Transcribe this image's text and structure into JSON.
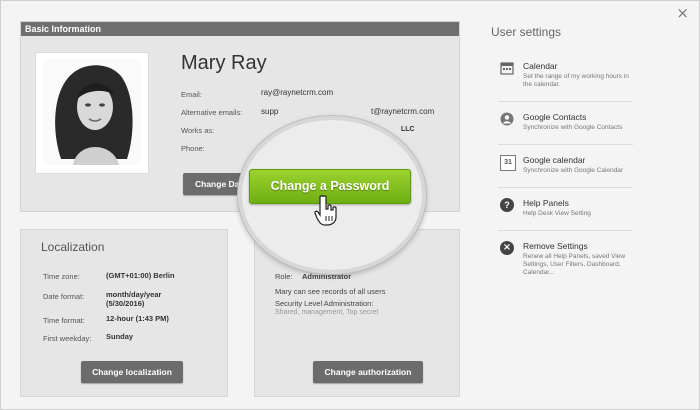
{
  "window": {
    "close_glyph": "×"
  },
  "basic": {
    "header": "Basic Information",
    "name": "Mary Ray",
    "email_label": "Email:",
    "email_value": "ray@raynetcrm.com",
    "alt_email_label": "Alternative emails:",
    "alt_email_value": "supp",
    "alt_email_value_right": "t@raynetcrm.com",
    "works_as_label": "Works as:",
    "works_as_value": "LLC",
    "phone_label": "Phone:",
    "change_data_label": "Change Da"
  },
  "password_button": {
    "label": "Change a Password"
  },
  "localization": {
    "title": "Localization",
    "rows": [
      {
        "label": "Time zone:",
        "value": "(GMT+01:00) Berlin"
      },
      {
        "label": "Date format:",
        "value": "month/day/year\n(5/30/2016)"
      },
      {
        "label": "Time format:",
        "value": "12-hour (1:43 PM)"
      },
      {
        "label": "First weekday:",
        "value": "Sunday"
      }
    ],
    "button": "Change localization"
  },
  "authorization": {
    "role_label": "Role:",
    "role_value": "Administrator",
    "records_text": "Mary can see records of all users",
    "security_label": "Security Level Administration:",
    "security_value": "Shared, management, Top secret",
    "button": "Change authorization"
  },
  "user_settings": {
    "title": "User settings",
    "items": [
      {
        "icon": "calendar-icon",
        "title": "Calendar",
        "desc": "Set the range of my working hours in the calendar."
      },
      {
        "icon": "contacts-icon",
        "title": "Google Contacts",
        "desc": "Synchronize with Google Contacts"
      },
      {
        "icon": "google-calendar-icon",
        "title": "Google calendar",
        "desc": "Synchronize with Google Calendar",
        "icon_text": "31"
      },
      {
        "icon": "help-icon",
        "title": "Help Panels",
        "desc": "Help Desk View Setting",
        "icon_text": "?"
      },
      {
        "icon": "remove-icon",
        "title": "Remove Settings",
        "desc": "Renew all Help Panels, saved View Settings, User Filters, Dashboard, Calendar...",
        "icon_text": "×"
      }
    ]
  }
}
